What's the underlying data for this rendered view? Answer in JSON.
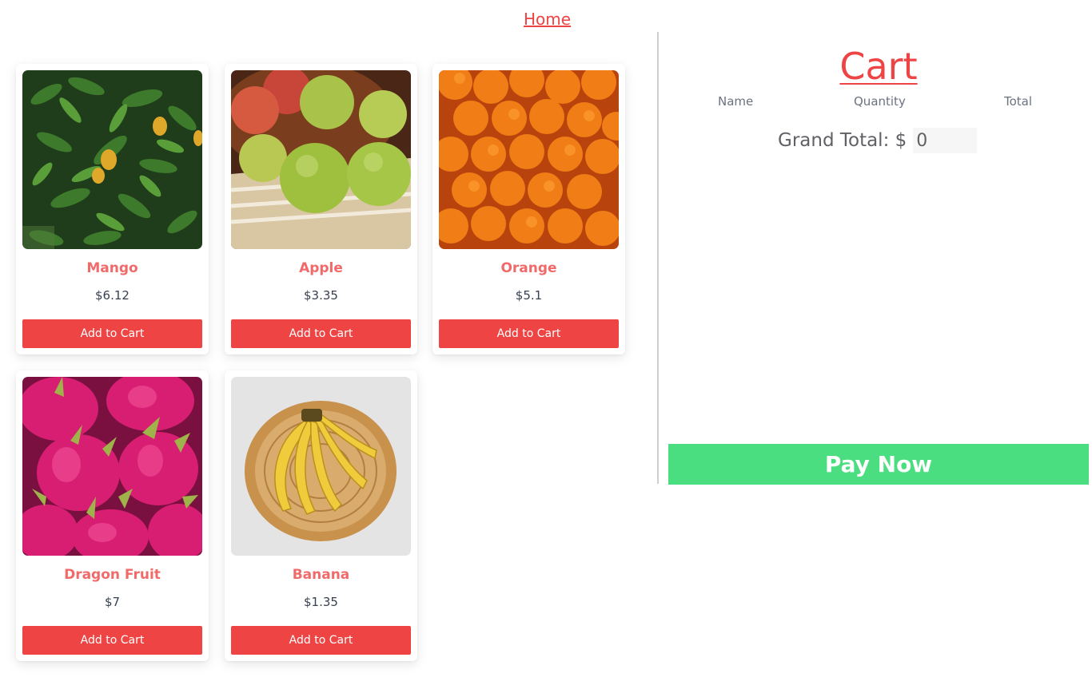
{
  "nav": {
    "home_label": "Home"
  },
  "products": [
    {
      "name": "Mango",
      "price": "$6.12",
      "button": "Add to Cart",
      "image": "mango-tree-photo"
    },
    {
      "name": "Apple",
      "price": "$3.35",
      "button": "Add to Cart",
      "image": "green-apples-photo"
    },
    {
      "name": "Orange",
      "price": "$5.1",
      "button": "Add to Cart",
      "image": "oranges-photo"
    },
    {
      "name": "Dragon Fruit",
      "price": "$7",
      "button": "Add to Cart",
      "image": "dragon-fruit-photo"
    },
    {
      "name": "Banana",
      "price": "$1.35",
      "button": "Add to Cart",
      "image": "banana-basket-photo"
    }
  ],
  "cart": {
    "title": "Cart",
    "headers": {
      "name": "Name",
      "quantity": "Quantity",
      "total": "Total"
    },
    "grand_total_label": "Grand Total: $",
    "grand_total_value": "0",
    "pay_label": "Pay Now"
  },
  "colors": {
    "accent_red": "#ef4444",
    "product_name": "#f16a6a",
    "pay_green": "#4ade80"
  }
}
